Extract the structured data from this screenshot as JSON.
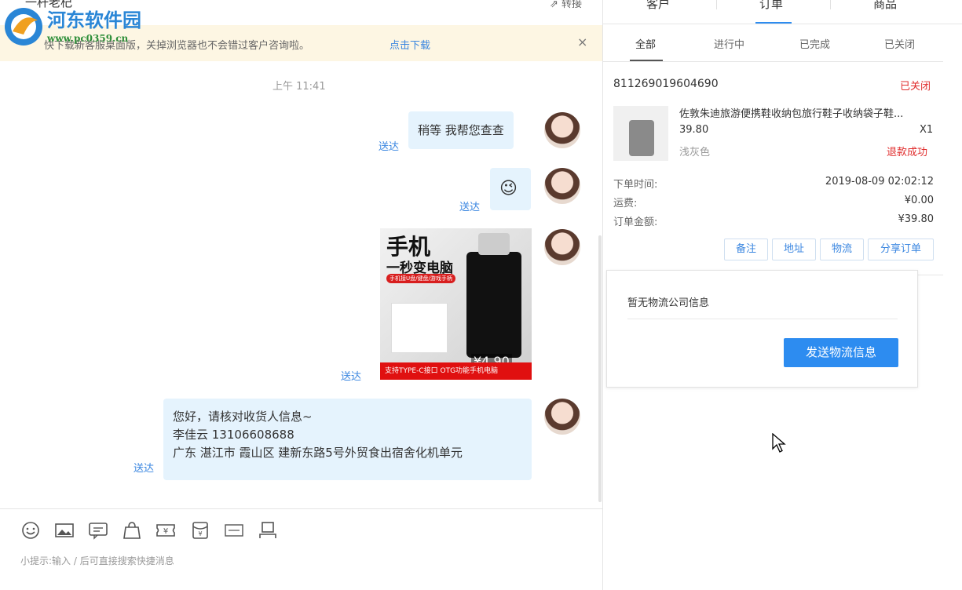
{
  "chat": {
    "title": "一杆老杞",
    "transfer_label": "转接",
    "banner": {
      "text": "快下载新客服桌面版，关掉浏览器也不会错过客户咨询啦。",
      "link": "点击下载",
      "close": "×"
    },
    "watermark": {
      "name": "河东软件园",
      "url": "www.pc0359.cn"
    },
    "time": "上午 11:41",
    "messages": [
      {
        "text": "稍等 我帮您查查",
        "status": "送达"
      },
      {
        "text": "😉",
        "status": "送达"
      },
      {
        "type": "image",
        "status": "送达",
        "image": {
          "headline": "手机",
          "subline": "一秒变电脑",
          "tag": "手机接U盘/键盘/游戏手柄",
          "price": "¥4.90",
          "footer": "支持TYPE-C接口 OTG功能手机电脑"
        }
      },
      {
        "lines": [
          "您好，请核对收货人信息~",
          "李佳云 13106608688",
          "广东 湛江市 霞山区 建新东路5号外贸食出宿舍化机单元"
        ],
        "status": "送达"
      }
    ],
    "toolbar_icons": [
      "emoji-icon",
      "image-icon",
      "quick-reply-icon",
      "shop-icon",
      "coupon-icon",
      "red-packet-icon",
      "invite-icon",
      "transfer-icon"
    ],
    "input_hint": "小提示:输入 / 后可直接搜索快捷消息"
  },
  "right": {
    "tabs": [
      "客户",
      "订单",
      "商品"
    ],
    "active_tab": "订单",
    "subtabs": [
      "全部",
      "进行中",
      "已完成",
      "已关闭"
    ],
    "active_subtab": "全部",
    "order": {
      "number": "811269019604690",
      "status": "已关闭",
      "product_title": "佐敦朱迪旅游便携鞋收纳包旅行鞋子收纳袋子鞋...",
      "price": "39.80",
      "qty": "X1",
      "color": "浅灰色",
      "refund": "退款成功",
      "fields": [
        {
          "label": "下单时间:",
          "value": "2019-08-09 02:02:12"
        },
        {
          "label": "运费:",
          "value": "¥0.00"
        },
        {
          "label": "订单金额:",
          "value": "¥39.80"
        }
      ],
      "buttons": [
        "备注",
        "地址",
        "物流",
        "分享订单"
      ]
    },
    "logistics": {
      "text": "暂无物流公司信息",
      "button": "发送物流信息"
    }
  },
  "colors": {
    "accent": "#2d8cf0",
    "bubble": "#e5f3fd",
    "danger": "#e02d2d",
    "banner": "#fdf6e3"
  }
}
